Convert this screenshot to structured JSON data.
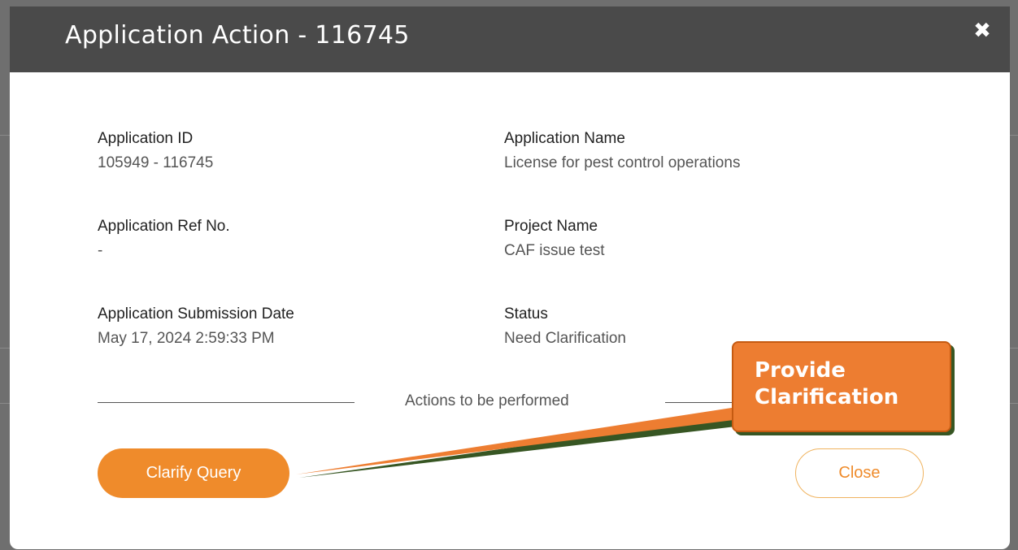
{
  "modal": {
    "title": "Application Action - 116745",
    "close_icon": "close-x-icon"
  },
  "details": {
    "application_id": {
      "label": "Application ID",
      "value": "105949 - 116745"
    },
    "application_name": {
      "label": "Application Name",
      "value": "License for pest control operations"
    },
    "application_ref_no": {
      "label": "Application Ref No.",
      "value": "-"
    },
    "project_name": {
      "label": "Project Name",
      "value": "CAF issue test"
    },
    "submission_date": {
      "label": "Application Submission Date",
      "value": "May 17, 2024 2:59:33 PM"
    },
    "status": {
      "label": "Status",
      "value": "Need Clarification"
    }
  },
  "actions": {
    "divider_text": "Actions to be performed",
    "clarify_label": "Clarify Query",
    "close_label": "Close"
  },
  "callout": {
    "line1": "Provide",
    "line2": "Clarification"
  },
  "colors": {
    "header_bg": "#4a4a4a",
    "accent_orange": "#ef8b2b",
    "callout_orange": "#ed7d31",
    "callout_shadow": "#375623"
  }
}
